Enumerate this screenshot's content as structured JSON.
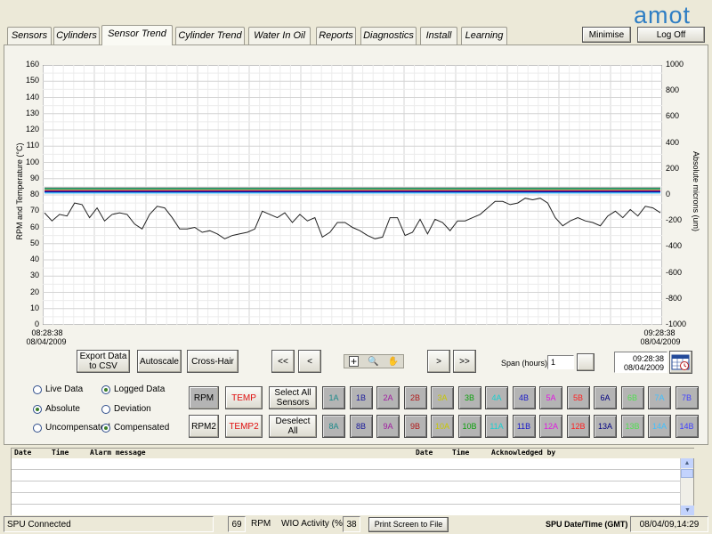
{
  "brand": "amot",
  "tabs": [
    {
      "label": "Sensors",
      "active": false
    },
    {
      "label": "Cylinders",
      "active": false
    },
    {
      "label": "Sensor Trend",
      "active": true
    },
    {
      "label": "Cylinder Trend",
      "active": false
    },
    {
      "label": "Water In Oil",
      "active": false
    },
    {
      "label": "Reports",
      "active": false
    },
    {
      "label": "Diagnostics",
      "active": false
    },
    {
      "label": "Install",
      "active": false
    },
    {
      "label": "Learning",
      "active": false
    }
  ],
  "header_buttons": {
    "minimise": "Minimise",
    "logoff": "Log Off"
  },
  "chart": {
    "left_axis_label": "RPM and Temperature (°C)",
    "right_axis_label": "Absolute microns (um)",
    "left_ticks": [
      "160",
      "150",
      "140",
      "130",
      "120",
      "110",
      "100",
      "90",
      "80",
      "70",
      "60",
      "50",
      "40",
      "30",
      "20",
      "10",
      "0"
    ],
    "right_ticks": [
      "1000",
      "800",
      "600",
      "400",
      "200",
      "0",
      "-200",
      "-400",
      "-600",
      "-800",
      "-1000"
    ],
    "start_time": "08:28:38",
    "start_date": "08/04/2009",
    "end_time": "09:28:38",
    "end_date": "08/04/2009",
    "ylim": [
      0,
      160
    ],
    "trace_values": [
      69,
      64,
      68,
      67,
      75,
      74,
      66,
      72,
      64,
      68,
      69,
      68,
      62,
      59,
      68,
      73,
      72,
      66,
      59,
      59,
      60,
      57,
      58,
      56,
      53,
      55,
      56,
      57,
      59,
      70,
      68,
      66,
      69,
      63,
      68,
      64,
      66,
      54,
      57,
      63,
      63,
      60,
      58,
      55,
      53,
      54,
      66,
      66,
      55,
      57,
      65,
      56,
      65,
      63,
      58,
      64,
      64,
      66,
      68,
      72,
      76,
      76,
      74,
      75,
      78,
      77,
      78,
      75,
      66,
      61,
      64,
      66,
      64,
      63,
      61,
      67,
      70,
      66,
      71,
      67,
      73,
      72,
      69
    ]
  },
  "controls": {
    "export": "Export Data to CSV",
    "autoscale": "Autoscale",
    "crosshair": "Cross-Hair",
    "rewind": "<<",
    "back": "<",
    "forward": ">",
    "fastforward": ">>",
    "span_label": "Span (hours)",
    "span_value": "1",
    "end_time": "09:28:38",
    "end_date": "08/04/2009"
  },
  "radios": {
    "live": "Live Data",
    "logged": "Logged Data",
    "absolute": "Absolute",
    "deviation": "Deviation",
    "uncompensated": "Uncompensated",
    "compensated": "Compensated"
  },
  "sensor_buttons": {
    "rpm": "RPM",
    "temp": "TEMP",
    "rpm2": "RPM2",
    "temp2": "TEMP2",
    "select_all": "Select All Sensors",
    "deselect_all": "Deselect All",
    "row1": [
      {
        "label": "1A",
        "color": "#1d8a8a"
      },
      {
        "label": "1B",
        "color": "#1a1a9a"
      },
      {
        "label": "2A",
        "color": "#a01aa0"
      },
      {
        "label": "2B",
        "color": "#b01a1a"
      },
      {
        "label": "3A",
        "color": "#c8c800"
      },
      {
        "label": "3B",
        "color": "#0aa00a"
      },
      {
        "label": "4A",
        "color": "#18d0d0"
      },
      {
        "label": "4B",
        "color": "#1818c8"
      },
      {
        "label": "5A",
        "color": "#e018e0"
      },
      {
        "label": "5B",
        "color": "#ff2020"
      },
      {
        "label": "6A",
        "color": "#000080"
      },
      {
        "label": "6B",
        "color": "#50e050"
      },
      {
        "label": "7A",
        "color": "#40c0ff"
      },
      {
        "label": "7B",
        "color": "#4040ff"
      }
    ],
    "row2": [
      {
        "label": "8A",
        "color": "#1d8a8a"
      },
      {
        "label": "8B",
        "color": "#1a1a9a"
      },
      {
        "label": "9A",
        "color": "#a01aa0"
      },
      {
        "label": "9B",
        "color": "#b01a1a"
      },
      {
        "label": "10A",
        "color": "#c8c800"
      },
      {
        "label": "10B",
        "color": "#0aa00a"
      },
      {
        "label": "11A",
        "color": "#18d0d0"
      },
      {
        "label": "11B",
        "color": "#1818c8"
      },
      {
        "label": "12A",
        "color": "#e018e0"
      },
      {
        "label": "12B",
        "color": "#ff2020"
      },
      {
        "label": "13A",
        "color": "#000080"
      },
      {
        "label": "13B",
        "color": "#50e050"
      },
      {
        "label": "14A",
        "color": "#40c0ff"
      },
      {
        "label": "14B",
        "color": "#4040ff"
      }
    ]
  },
  "alarm_table": {
    "date": "Date",
    "time": "Time",
    "message": "Alarm message",
    "date2": "Date",
    "time2": "Time",
    "ack": "Acknowledged by"
  },
  "status": {
    "connection": "SPU Connected",
    "rpm_value": "69",
    "rpm_label": "RPM",
    "wio_label": "WIO Activity (%)",
    "wio_value": "38",
    "print": "Print Screen to File",
    "spu_label": "SPU Date/Time (GMT)",
    "spu_value": "08/04/09,14:29"
  }
}
